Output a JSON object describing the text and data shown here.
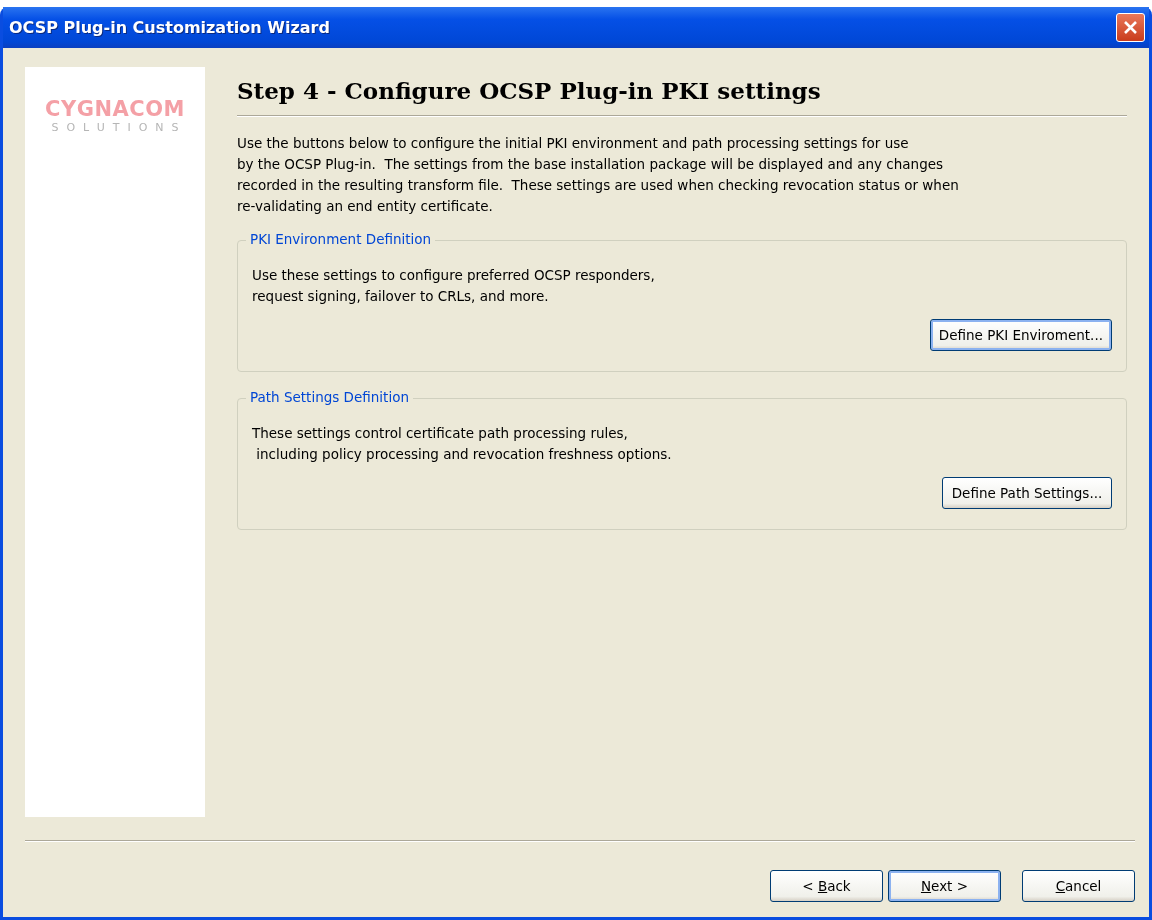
{
  "window": {
    "title": "OCSP Plug-in Customization Wizard"
  },
  "logo": {
    "name": "CYGNACOM",
    "tagline": "SOLUTIONS"
  },
  "heading": "Step 4 - Configure OCSP Plug-in PKI settings",
  "intro": [
    "Use the buttons below to configure the initial PKI environment and path processing settings for use",
    "by the OCSP Plug-in.  The settings from the base installation package will be displayed and any changes",
    "recorded in the resulting transform file.  These settings are used when checking revocation status or when",
    "re-validating an end entity certificate."
  ],
  "groups": [
    {
      "title": "PKI Environment Definition",
      "lines": [
        "Use these settings to configure preferred OCSP responders,",
        "request signing, failover to CRLs, and more."
      ],
      "button": {
        "label": "Define PKI Enviroment...",
        "focused": true
      }
    },
    {
      "title": "Path Settings Definition",
      "lines": [
        "These settings control certificate path processing rules,",
        " including policy processing and revocation freshness options."
      ],
      "button": {
        "label": "Define Path Settings...",
        "focused": false
      }
    }
  ],
  "buttons": [
    {
      "before": "< ",
      "key": "B",
      "after": "ack",
      "default": false
    },
    {
      "key": "N",
      "after": "ext >",
      "default": true
    },
    {
      "key": "C",
      "after": "ancel",
      "default": false
    }
  ]
}
